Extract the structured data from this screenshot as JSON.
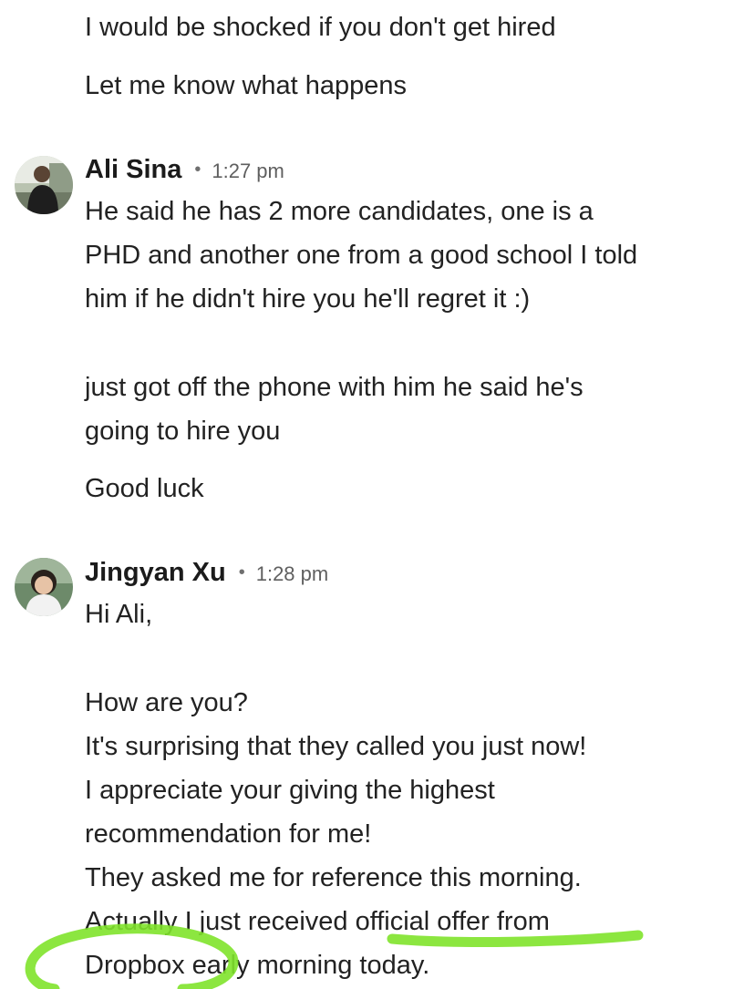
{
  "conversation": {
    "pre_lines": [
      "I would be shocked if you don't get hired",
      "Let me know what happens"
    ],
    "messages": [
      {
        "sender": "Ali Sina",
        "time": "1:27 pm",
        "avatar_icon": "person-photo-icon",
        "lines": [
          "He said he has 2 more candidates, one is a",
          "PHD and another one from a good school I told",
          "him if he didn't hire you he'll regret it :)",
          " just got off the phone with him he said he's",
          "going to hire you",
          "Good luck"
        ]
      },
      {
        "sender": "Jingyan Xu",
        "time": "1:28 pm",
        "avatar_icon": "person-photo-icon",
        "lines": [
          "Hi Ali,",
          "How are you?",
          "It's surprising that they called you just now!",
          "I appreciate your giving the highest",
          "recommendation for me!",
          "They asked me for reference this morning.",
          "Actually I just received official offer from",
          "Dropbox early morning today."
        ]
      }
    ]
  },
  "annotation": {
    "highlight_color": "#7fe32b"
  }
}
